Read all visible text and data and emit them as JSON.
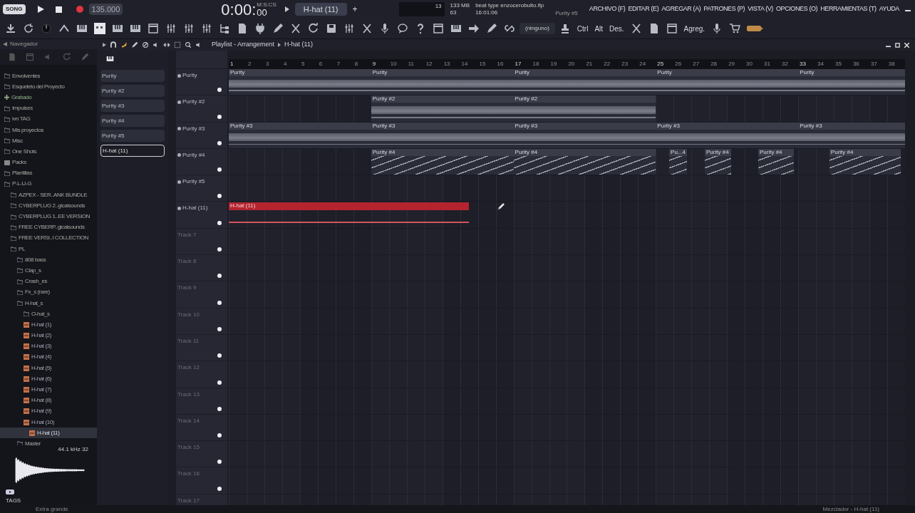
{
  "transport": {
    "mode": "SONG",
    "tempo": "135.000",
    "time": "0:00:",
    "time_cs": "00",
    "time_format": "M:S:CS",
    "pattern": "H-hat (11)",
    "add": "+"
  },
  "hint_panel": {
    "counter": "13",
    "memory": "133 MB",
    "polyphony": "63",
    "project": "beat type enzocerobulto.flp",
    "clock": "16:01:06",
    "current": "Purity #5"
  },
  "menu": [
    "ARCHIVO (F)",
    "EDITAR (E)",
    "AGREGAR (A)",
    "PATRONES (P)",
    "VISTA (V)",
    "OPCIONES (O)",
    "HERRAMIENTAS (T)",
    "AYUDA"
  ],
  "toolbar": [
    {
      "kind": "download"
    },
    {
      "kind": "loop"
    },
    {
      "kind": "knob"
    },
    {
      "kind": "arrow"
    },
    {
      "kind": "piano"
    },
    {
      "kind": "grid"
    },
    {
      "kind": "piano"
    },
    {
      "kind": "piano"
    },
    {
      "kind": "window"
    },
    {
      "kind": "mixer"
    },
    {
      "kind": "mixer"
    },
    {
      "kind": "mixer"
    },
    {
      "kind": "tree"
    },
    {
      "kind": "file"
    },
    {
      "kind": "plug"
    },
    {
      "kind": "pencil"
    },
    {
      "kind": "scissors"
    },
    {
      "kind": "refresh"
    },
    {
      "kind": "disk"
    },
    {
      "kind": "mixer"
    },
    {
      "kind": "scissors"
    },
    {
      "kind": "mic"
    },
    {
      "kind": "speech"
    },
    {
      "kind": "help"
    },
    {
      "kind": "window"
    },
    {
      "kind": "piano"
    },
    {
      "kind": "arrow-right"
    },
    {
      "kind": "pencil"
    },
    {
      "kind": "link"
    },
    {
      "kind": "field",
      "label": "(ninguno)"
    },
    {
      "kind": "stamp"
    },
    {
      "kind": "text",
      "label": "Ctrl"
    },
    {
      "kind": "text",
      "label": "Alt"
    },
    {
      "kind": "text",
      "label": "Des."
    },
    {
      "kind": "scissors"
    },
    {
      "kind": "file"
    },
    {
      "kind": "window"
    },
    {
      "kind": "text",
      "label": "Agreg."
    },
    {
      "kind": "mic"
    },
    {
      "kind": "cart"
    },
    {
      "kind": "battery"
    }
  ],
  "browser": {
    "title": "Navegador",
    "items": [
      {
        "label": "Envolventes",
        "kind": "folder",
        "selected": false
      },
      {
        "label": "Esqueleto del Proyecto",
        "kind": "folder",
        "selected": false
      },
      {
        "label": "Grabado",
        "kind": "plus",
        "selected": false
      },
      {
        "label": "Impulses",
        "kind": "folder",
        "selected": false
      },
      {
        "label": "ivn TAG",
        "kind": "folder",
        "selected": false
      },
      {
        "label": "Mis proyectos",
        "kind": "folder",
        "selected": false
      },
      {
        "label": "Misc",
        "kind": "folder",
        "selected": false
      },
      {
        "label": "One Shots",
        "kind": "folder",
        "selected": false
      },
      {
        "label": "Packs",
        "kind": "pack",
        "selected": false
      },
      {
        "label": "Plantillas",
        "kind": "folder",
        "selected": false
      },
      {
        "label": "P-L-U-G",
        "kind": "folder",
        "selected": false,
        "children": [
          {
            "label": "AZPEX - SER..ANK BUNDLE",
            "kind": "folder",
            "selected": false
          },
          {
            "label": "CYBERPLUG 2..gicalsounds",
            "kind": "folder",
            "selected": false
          },
          {
            "label": "CYBERPLUG 1..EE VERSION",
            "kind": "folder",
            "selected": false
          },
          {
            "label": "FREE CYBERP..gicalsounds",
            "kind": "folder",
            "selected": false
          },
          {
            "label": "FREE VERSI..I COLLECTION",
            "kind": "folder",
            "selected": false
          },
          {
            "label": "PL",
            "kind": "folder",
            "selected": false,
            "children": [
              {
                "label": "808 bass",
                "kind": "folder",
                "selected": false
              },
              {
                "label": "Clap_s",
                "kind": "folder",
                "selected": false
              },
              {
                "label": "Crash_es",
                "kind": "folder",
                "selected": false
              },
              {
                "label": "Fx_s (rare)",
                "kind": "folder",
                "selected": false
              },
              {
                "label": "H-hat_s",
                "kind": "folder",
                "selected": false,
                "children": [
                  {
                    "label": "O-hat_s",
                    "kind": "folder",
                    "selected": false
                  },
                  {
                    "label": "H-hat (1)",
                    "kind": "file",
                    "selected": false
                  },
                  {
                    "label": "H-hat (2)",
                    "kind": "file",
                    "selected": false
                  },
                  {
                    "label": "H-hat (3)",
                    "kind": "file",
                    "selected": false
                  },
                  {
                    "label": "H-hat (4)",
                    "kind": "file",
                    "selected": false
                  },
                  {
                    "label": "H-hat (5)",
                    "kind": "file",
                    "selected": false
                  },
                  {
                    "label": "H-hat (6)",
                    "kind": "file",
                    "selected": false
                  },
                  {
                    "label": "H-hat (7)",
                    "kind": "file",
                    "selected": false
                  },
                  {
                    "label": "H-hat (8)",
                    "kind": "file",
                    "selected": false
                  },
                  {
                    "label": "H-hat (9)",
                    "kind": "file",
                    "selected": false
                  },
                  {
                    "label": "H-hat (10)",
                    "kind": "file",
                    "selected": false
                  },
                  {
                    "label": "H-hat (11)",
                    "kind": "file",
                    "selected": true
                  }
                ]
              },
              {
                "label": "Master",
                "kind": "folder",
                "selected": false
              }
            ]
          }
        ]
      }
    ],
    "sample_info": "44.1 kHz 32",
    "tags": "TAGS"
  },
  "playlist": {
    "title": "Playlist - Arrangement",
    "pattern": "H-hat (11)",
    "patterns": [
      {
        "name": "Purity",
        "selected": false
      },
      {
        "name": "Purity #2",
        "selected": false
      },
      {
        "name": "Purity #3",
        "selected": false
      },
      {
        "name": "Purity #4",
        "selected": false
      },
      {
        "name": "Purity #5",
        "selected": false
      },
      {
        "name": "H-hat (11)",
        "selected": true
      }
    ],
    "ruler": [
      "1",
      "2",
      "3",
      "4",
      "5",
      "6",
      "7",
      "8",
      "9",
      "10",
      "11",
      "12",
      "13",
      "14",
      "15",
      "16",
      "17",
      "18",
      "19",
      "20",
      "21",
      "22",
      "23",
      "24",
      "25",
      "26",
      "27",
      "28",
      "29",
      "30",
      "31",
      "32",
      "33",
      "34",
      "35",
      "36",
      "37",
      "38"
    ],
    "tracks": [
      {
        "name": "Purity",
        "kind": "melody",
        "clips": [
          "Purity",
          "Purity",
          "Purity",
          "Purity",
          "Purity"
        ]
      },
      {
        "name": "Purity #2",
        "kind": "melody",
        "clips": [
          "Purity #2",
          "Purity #2"
        ]
      },
      {
        "name": "Purity #3",
        "kind": "melody",
        "clips": [
          "Purity #3",
          "Purity #3",
          "Purity #3",
          "Purity #3",
          "Purity #3"
        ]
      },
      {
        "name": "Purity #4",
        "kind": "drums",
        "clips": [
          "Purity #4",
          "Purity #4",
          "Pu...4",
          "Purity #4",
          "Purity #4",
          "Purity #4"
        ]
      },
      {
        "name": "Purity #5",
        "kind": "melody"
      },
      {
        "name": "H-hat (11)",
        "kind": "audio",
        "clips": [
          "H-hat (11)"
        ]
      },
      {
        "name": "Track 7",
        "kind": "empty"
      },
      {
        "name": "Track 8",
        "kind": "empty"
      },
      {
        "name": "Track 9",
        "kind": "empty"
      },
      {
        "name": "Track 10",
        "kind": "empty"
      },
      {
        "name": "Track 11",
        "kind": "empty"
      },
      {
        "name": "Track 12",
        "kind": "empty"
      },
      {
        "name": "Track 13",
        "kind": "empty"
      },
      {
        "name": "Track 14",
        "kind": "empty"
      },
      {
        "name": "Track 15",
        "kind": "empty"
      },
      {
        "name": "Track 16",
        "kind": "empty"
      },
      {
        "name": "Track 17",
        "kind": "empty"
      }
    ]
  },
  "status_bar": {
    "left": "Extra grande",
    "right": "Mezclador - H-hat (11)"
  }
}
